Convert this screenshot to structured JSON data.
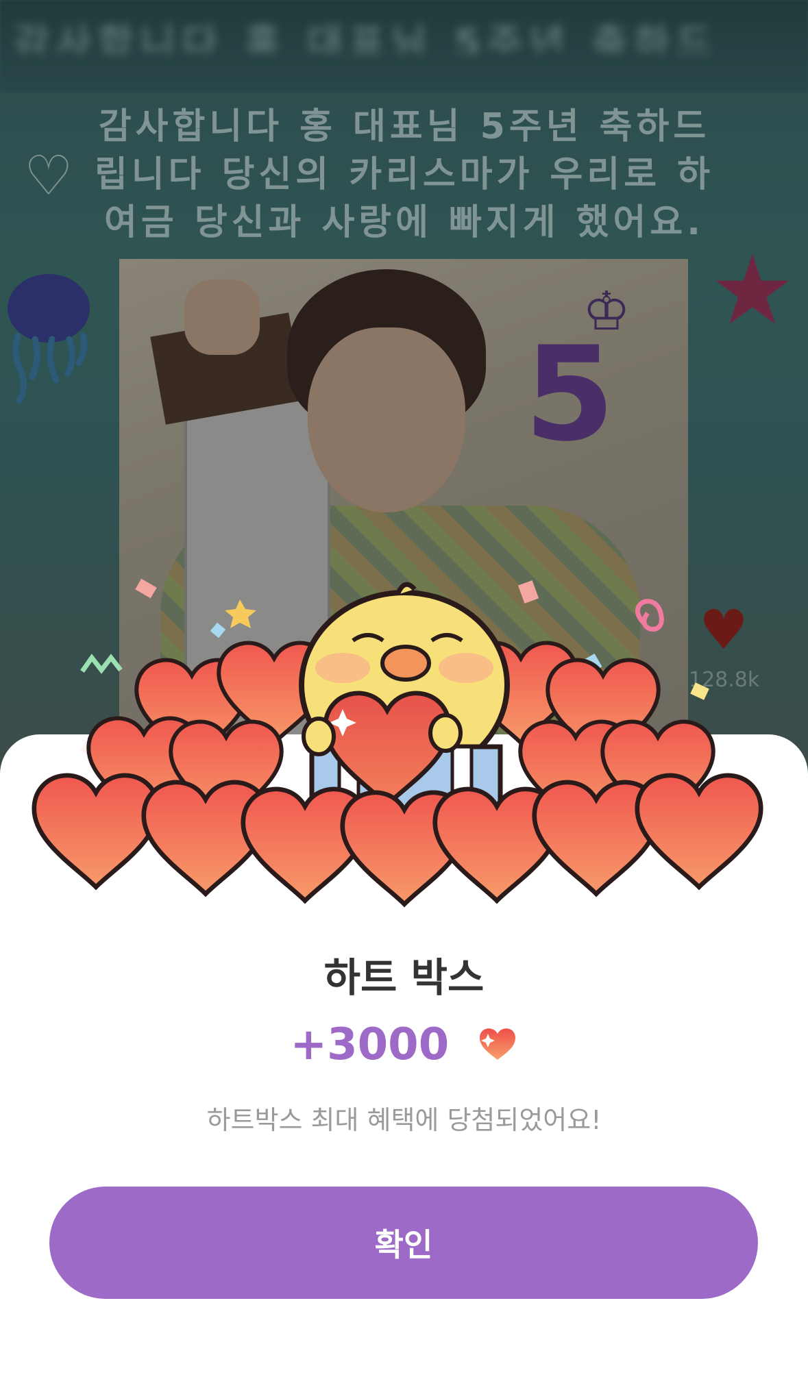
{
  "background_post": {
    "blurred_header": "감사합니다 홍 대표님 5주년 축하드",
    "caption_lines": [
      "감사합니다 홍 대표님 5주년 축하드",
      "립니다 당신의 카리스마가 우리로 하",
      "여금 당신과 사랑에 빠지게 했어요."
    ],
    "badge_number": "5",
    "like_count": "128.8k"
  },
  "reward": {
    "title": "하트 박스",
    "amount": "+3000",
    "description": "하트박스 최대 혜택에 당첨되었어요!",
    "confirm_label": "확인"
  },
  "colors": {
    "accent": "#9E6AC8",
    "heart": "#F26B5B"
  }
}
